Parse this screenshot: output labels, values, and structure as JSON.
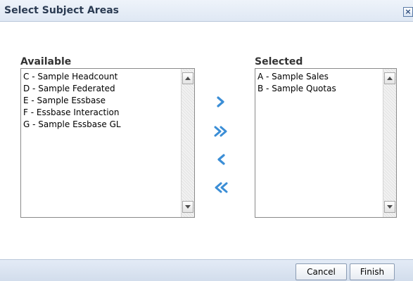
{
  "dialog": {
    "title": "Select Subject Areas",
    "close_icon": "close-icon",
    "close_label": "×"
  },
  "available": {
    "label": "Available",
    "items": [
      "C - Sample Headcount",
      "D - Sample Federated",
      "E - Sample Essbase",
      "F - Essbase Interaction",
      "G - Sample Essbase GL"
    ]
  },
  "selected": {
    "label": "Selected",
    "items": [
      "A - Sample Sales",
      "B - Sample Quotas"
    ]
  },
  "move_buttons": [
    {
      "name": "move-right",
      "icon": "chevron-right-icon"
    },
    {
      "name": "move-all-right",
      "icon": "double-chevron-right-icon"
    },
    {
      "name": "move-left",
      "icon": "chevron-left-icon"
    },
    {
      "name": "move-all-left",
      "icon": "double-chevron-left-icon"
    }
  ],
  "footer": {
    "cancel_label": "Cancel",
    "finish_label": "Finish"
  },
  "colors": {
    "accent_blue": "#3b8ed6",
    "title_text": "#2b3b52",
    "header_bg": "#dfe8f4"
  }
}
